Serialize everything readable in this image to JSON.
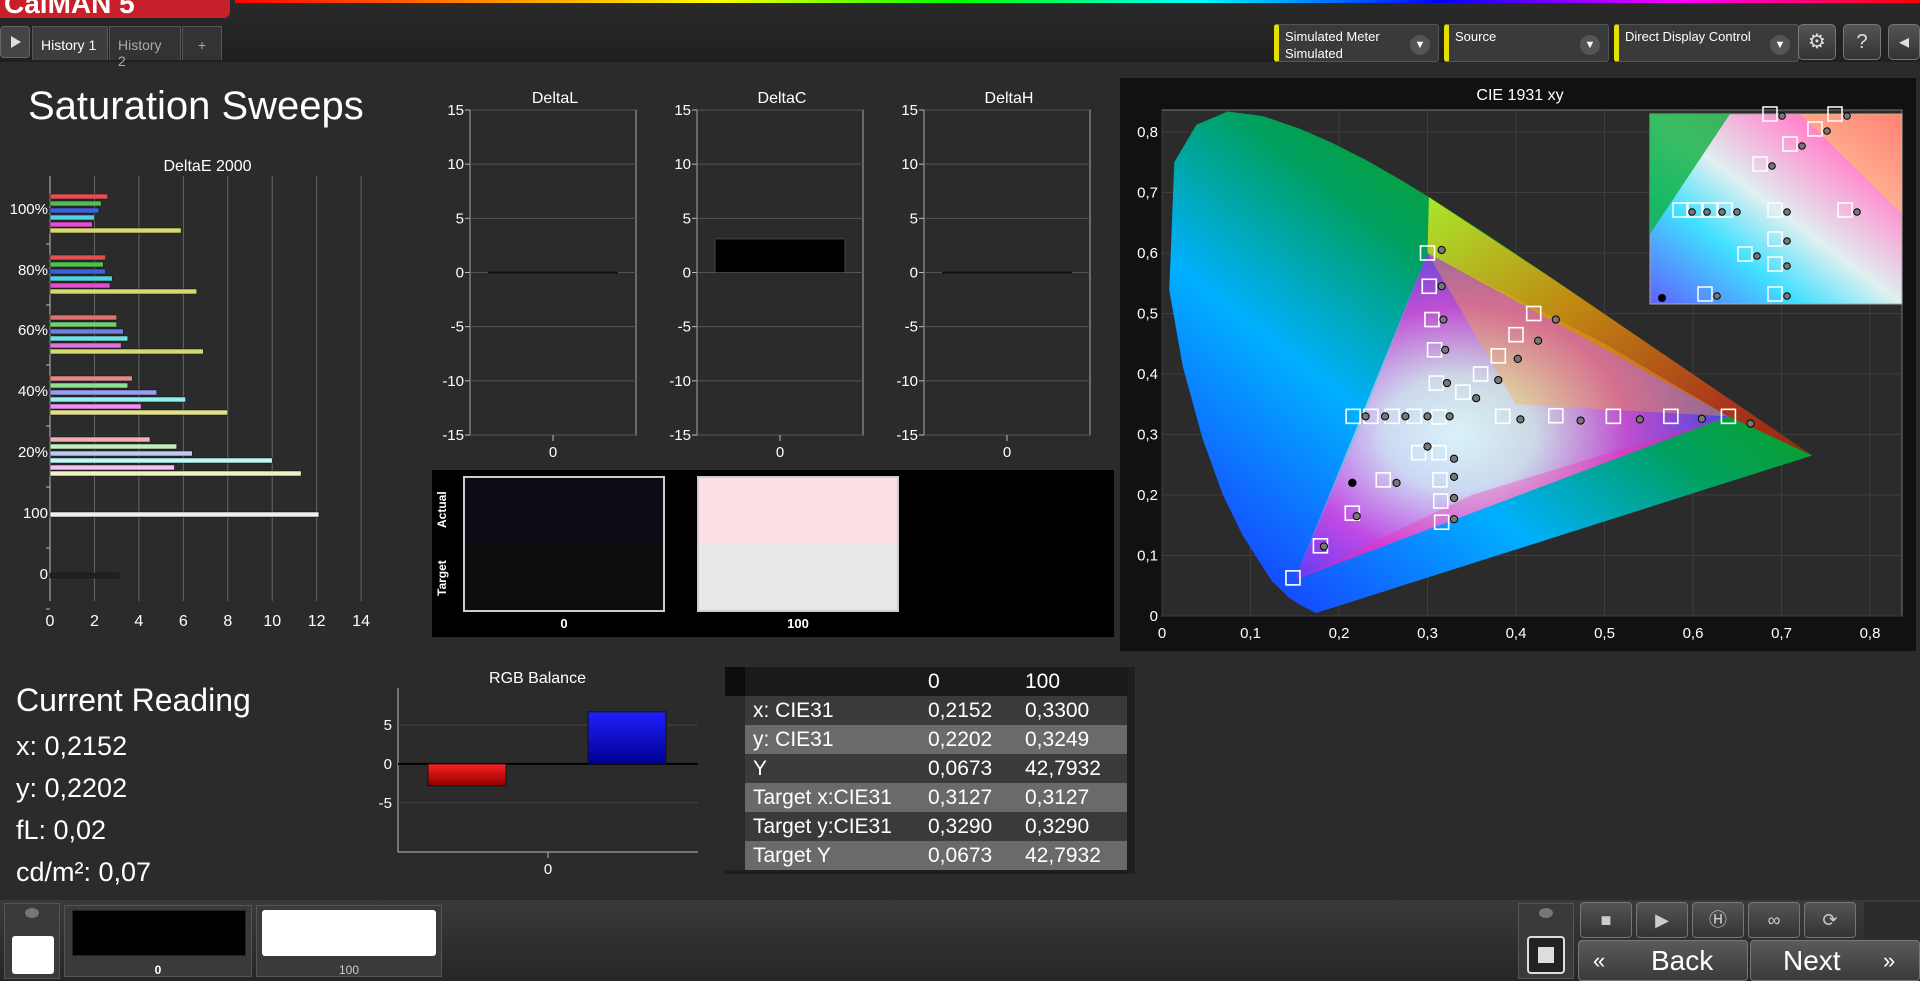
{
  "app": {
    "logo": "CalMAN 5"
  },
  "tabs": [
    {
      "label": "History 1",
      "active": true
    },
    {
      "label": "History 2",
      "active": false
    },
    {
      "label": "+",
      "active": false
    }
  ],
  "header": {
    "meter": {
      "line1": "Simulated Meter",
      "line2": "Simulated"
    },
    "source": {
      "line1": "Source",
      "line2": ""
    },
    "display": {
      "line1": "Direct Display Control",
      "line2": ""
    },
    "icons": [
      "gear-icon",
      "help-icon",
      "collapse-icon"
    ]
  },
  "page_title": "Saturation Sweeps",
  "deltae_chart": {
    "title": "DeltaE 2000",
    "xticks": [
      "0",
      "2",
      "4",
      "6",
      "8",
      "10",
      "12",
      "14"
    ],
    "xmax": 15,
    "groups": [
      {
        "label": "100%",
        "bars": [
          {
            "v": 2.6,
            "c": "#e05050"
          },
          {
            "v": 2.3,
            "c": "#4fc050"
          },
          {
            "v": 2.2,
            "c": "#4060e0"
          },
          {
            "v": 2.0,
            "c": "#50d0e0"
          },
          {
            "v": 1.9,
            "c": "#e050d0"
          },
          {
            "v": 5.9,
            "c": "#d8d870"
          }
        ]
      },
      {
        "label": "80%",
        "bars": [
          {
            "v": 2.5,
            "c": "#e05050"
          },
          {
            "v": 2.4,
            "c": "#4fc050"
          },
          {
            "v": 2.5,
            "c": "#4060e0"
          },
          {
            "v": 2.8,
            "c": "#50d0e0"
          },
          {
            "v": 2.7,
            "c": "#e050d0"
          },
          {
            "v": 6.6,
            "c": "#d8d870"
          }
        ]
      },
      {
        "label": "60%",
        "bars": [
          {
            "v": 3.0,
            "c": "#e07070"
          },
          {
            "v": 3.0,
            "c": "#70d070"
          },
          {
            "v": 3.3,
            "c": "#7080e0"
          },
          {
            "v": 3.5,
            "c": "#70e0e0"
          },
          {
            "v": 3.2,
            "c": "#e070e0"
          },
          {
            "v": 6.9,
            "c": "#d8d870"
          }
        ]
      },
      {
        "label": "40%",
        "bars": [
          {
            "v": 3.7,
            "c": "#e08a8a"
          },
          {
            "v": 3.5,
            "c": "#90e090"
          },
          {
            "v": 4.8,
            "c": "#9aa0f0"
          },
          {
            "v": 6.1,
            "c": "#90f0f0"
          },
          {
            "v": 4.1,
            "c": "#f090f0"
          },
          {
            "v": 8.0,
            "c": "#e0e090"
          }
        ]
      },
      {
        "label": "20%",
        "bars": [
          {
            "v": 4.5,
            "c": "#f0b0b0"
          },
          {
            "v": 5.7,
            "c": "#c0f0c0"
          },
          {
            "v": 6.4,
            "c": "#c0c8f8"
          },
          {
            "v": 10.0,
            "c": "#c0f8f8"
          },
          {
            "v": 5.6,
            "c": "#f8c0f8"
          },
          {
            "v": 11.3,
            "c": "#f0f0c0"
          }
        ]
      },
      {
        "label": "100",
        "bars": [
          {
            "v": 12.1,
            "c": "#f0f0f0"
          }
        ]
      },
      {
        "label": "0",
        "bars": [
          {
            "v": 3.1,
            "c": "#202020"
          }
        ]
      }
    ]
  },
  "delta_charts": [
    {
      "title": "DeltaL",
      "yticks": [
        "15",
        "10",
        "5",
        "0",
        "-5",
        "-10",
        "-15"
      ],
      "xlabel": "0",
      "value": 0.0
    },
    {
      "title": "DeltaC",
      "yticks": [
        "15",
        "10",
        "5",
        "0",
        "-5",
        "-10",
        "-15"
      ],
      "xlabel": "0",
      "value": 3.1
    },
    {
      "title": "DeltaH",
      "yticks": [
        "15",
        "10",
        "5",
        "0",
        "-5",
        "-10",
        "-15"
      ],
      "xlabel": "0",
      "value": 0.0
    }
  ],
  "swatches": {
    "actual_label": "Actual",
    "target_label": "Target",
    "items": [
      {
        "label": "0",
        "actual": "#0b0c16",
        "target": "#0d0d0d"
      },
      {
        "label": "100",
        "actual": "#fde0e6",
        "target": "#e8e8e8"
      }
    ]
  },
  "cie": {
    "title": "CIE 1931 xy",
    "xticks": [
      "0",
      "0,1",
      "0,2",
      "0,3",
      "0,4",
      "0,5",
      "0,6",
      "0,7",
      "0,8"
    ],
    "yticks": [
      "0",
      "0,1",
      "0,2",
      "0,3",
      "0,4",
      "0,5",
      "0,6",
      "0,7",
      "0,8"
    ],
    "targets": [
      [
        0.148,
        0.063
      ],
      [
        0.179,
        0.116
      ],
      [
        0.215,
        0.17
      ],
      [
        0.25,
        0.225
      ],
      [
        0.29,
        0.27
      ],
      [
        0.3127,
        0.329
      ],
      [
        0.3,
        0.6
      ],
      [
        0.302,
        0.545
      ],
      [
        0.305,
        0.49
      ],
      [
        0.308,
        0.44
      ],
      [
        0.31,
        0.385
      ],
      [
        0.385,
        0.33
      ],
      [
        0.445,
        0.331
      ],
      [
        0.51,
        0.33
      ],
      [
        0.575,
        0.33
      ],
      [
        0.64,
        0.33
      ],
      [
        0.313,
        0.27
      ],
      [
        0.314,
        0.225
      ],
      [
        0.315,
        0.19
      ],
      [
        0.316,
        0.155
      ],
      [
        0.42,
        0.5
      ],
      [
        0.4,
        0.465
      ],
      [
        0.38,
        0.43
      ],
      [
        0.36,
        0.4
      ],
      [
        0.34,
        0.37
      ],
      [
        0.216,
        0.33
      ],
      [
        0.236,
        0.33
      ],
      [
        0.26,
        0.33
      ],
      [
        0.285,
        0.33
      ]
    ],
    "measured": [
      [
        0.215,
        0.22
      ],
      [
        0.325,
        0.33
      ],
      [
        0.316,
        0.605
      ],
      [
        0.316,
        0.545
      ],
      [
        0.318,
        0.49
      ],
      [
        0.32,
        0.44
      ],
      [
        0.322,
        0.385
      ],
      [
        0.405,
        0.325
      ],
      [
        0.473,
        0.323
      ],
      [
        0.54,
        0.325
      ],
      [
        0.61,
        0.326
      ],
      [
        0.665,
        0.318
      ],
      [
        0.33,
        0.26
      ],
      [
        0.33,
        0.23
      ],
      [
        0.33,
        0.195
      ],
      [
        0.33,
        0.16
      ],
      [
        0.445,
        0.49
      ],
      [
        0.425,
        0.455
      ],
      [
        0.402,
        0.425
      ],
      [
        0.38,
        0.39
      ],
      [
        0.355,
        0.36
      ],
      [
        0.23,
        0.33
      ],
      [
        0.252,
        0.33
      ],
      [
        0.275,
        0.33
      ],
      [
        0.3,
        0.33
      ],
      [
        0.265,
        0.22
      ],
      [
        0.3,
        0.28
      ],
      [
        0.183,
        0.115
      ],
      [
        0.22,
        0.165
      ]
    ],
    "current": [
      0.2152,
      0.2202
    ]
  },
  "rgb_balance": {
    "title": "RGB Balance",
    "yticks": [
      "5",
      "0",
      "-5"
    ],
    "xlabel": "0",
    "red": -2.8,
    "green": 0.0,
    "blue": 6.7
  },
  "current_reading": {
    "title": "Current Reading",
    "lines": [
      "x: 0,2152",
      "y: 0,2202",
      "fL: 0,02",
      "cd/m²: 0,07"
    ]
  },
  "reading_table": {
    "header": [
      "",
      "0",
      "100"
    ],
    "rows": [
      [
        "x: CIE31",
        "0,2152",
        "0,3300"
      ],
      [
        "y: CIE31",
        "0,2202",
        "0,3249"
      ],
      [
        "Y",
        "0,0673",
        "42,7932"
      ],
      [
        "Target x:CIE31",
        "0,3127",
        "0,3127"
      ],
      [
        "Target y:CIE31",
        "0,3290",
        "0,3290"
      ],
      [
        "Target Y",
        "0,0673",
        "42,7932"
      ]
    ]
  },
  "bottom": {
    "swatch_labels": [
      "0",
      "100"
    ],
    "back": "Back",
    "next": "Next",
    "controls": [
      "stop-icon",
      "play-icon",
      "hold-icon",
      "loop-icon",
      "refresh-icon"
    ]
  }
}
